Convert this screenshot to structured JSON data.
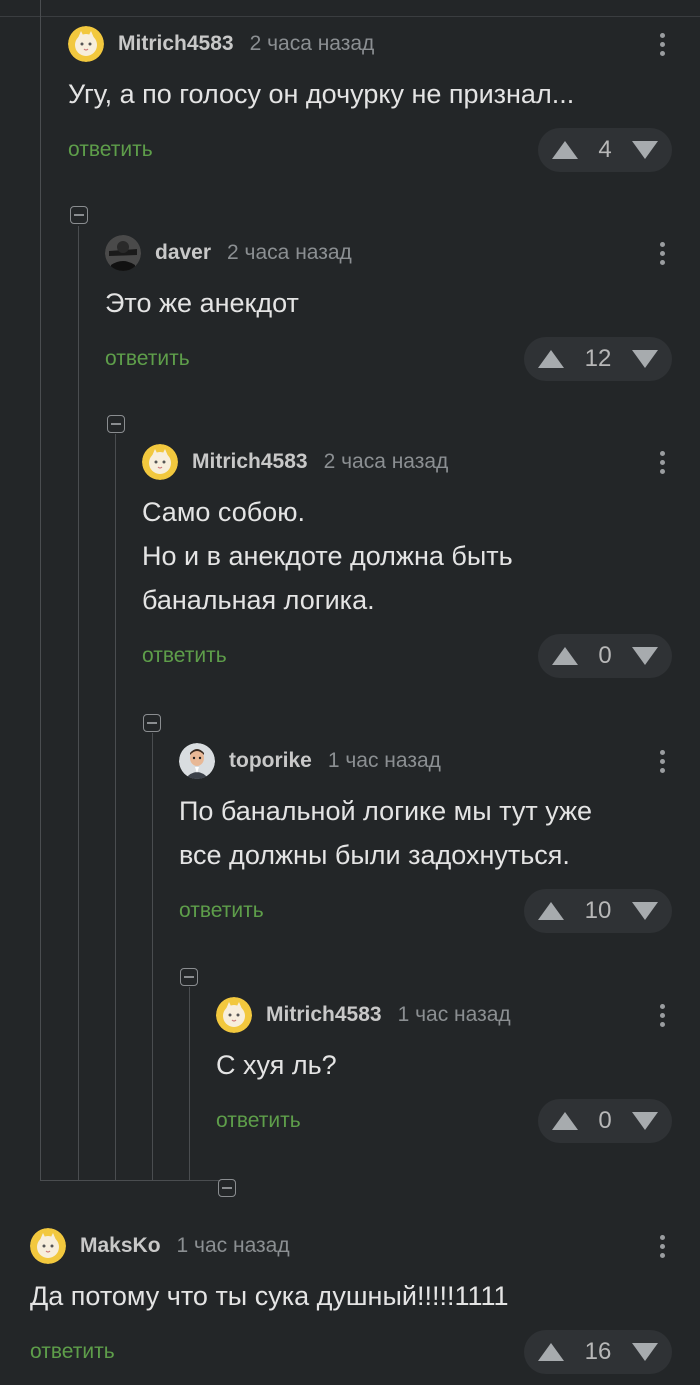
{
  "comments": [
    {
      "author": "Mitrich4583",
      "time": "2 часа назад",
      "lines": [
        "Угу, а по голосу он дочурку не признал..."
      ],
      "reply": "ответить",
      "rating": "4",
      "avatar": "cat-avatar-icon"
    },
    {
      "author": "daver",
      "time": "2 часа назад",
      "lines": [
        "Это же анекдот"
      ],
      "reply": "ответить",
      "rating": "12",
      "avatar": "dark-avatar-icon"
    },
    {
      "author": "Mitrich4583",
      "time": "2 часа назад",
      "lines": [
        "Само собою.",
        "Но и в анекдоте должна быть",
        "банальная логика."
      ],
      "reply": "ответить",
      "rating": "0",
      "avatar": "cat-avatar-icon"
    },
    {
      "author": "toporike",
      "time": "1 час назад",
      "lines": [
        "По банальной логике мы тут уже",
        "все должны были задохнуться."
      ],
      "reply": "ответить",
      "rating": "10",
      "avatar": "person-avatar-icon"
    },
    {
      "author": "Mitrich4583",
      "time": "1 час назад",
      "lines": [
        "С хуя ль?"
      ],
      "reply": "ответить",
      "rating": "0",
      "avatar": "cat-avatar-icon"
    },
    {
      "author": "MaksKo",
      "time": "1 час назад",
      "lines": [
        "Да потому что ты сука душный!!!!!1111"
      ],
      "reply": "ответить",
      "rating": "16",
      "avatar": "cat-avatar-icon"
    }
  ],
  "colors": {
    "background": "#232628",
    "reply_link": "#5e9e4a",
    "rating_pill": "#2f3235"
  }
}
